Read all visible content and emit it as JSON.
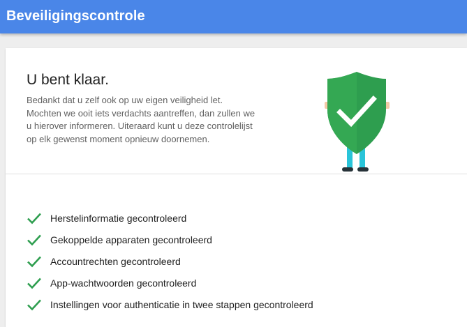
{
  "app_bar": {
    "title": "Beveiligingscontrole",
    "color": "#4a86e8"
  },
  "summary": {
    "heading": "U bent klaar.",
    "text": "Bedankt dat u zelf ook op uw eigen veiligheid let. Mochten we ooit iets verdachts aantreffen, dan zullen we u hierover informeren. Uiteraard kunt u deze controlelijst op elk gewenst moment opnieuw doornemen.",
    "illustration": "shield-with-checkmark-character",
    "shield_color": "#2e9e4f"
  },
  "checklist": {
    "icon": "check-icon",
    "icon_color": "#2e9e4f",
    "items": [
      "Herstelinformatie gecontroleerd",
      "Gekoppelde apparaten gecontroleerd",
      "Accountrechten gecontroleerd",
      "App-wachtwoorden gecontroleerd",
      "Instellingen voor authenticatie in twee stappen gecontroleerd"
    ]
  }
}
